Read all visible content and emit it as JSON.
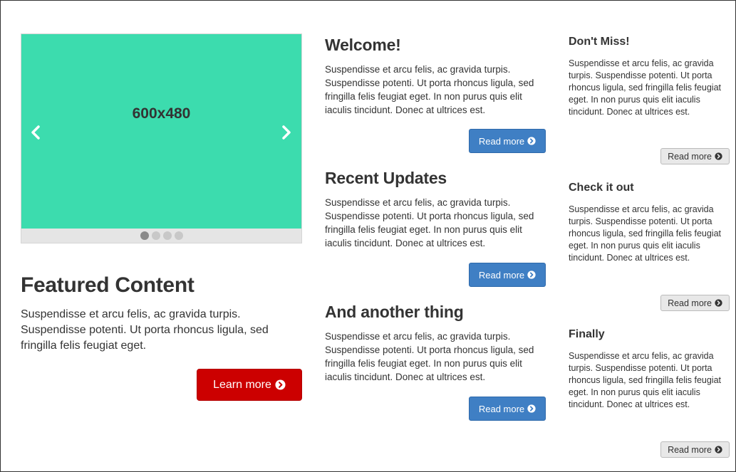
{
  "carousel": {
    "slide_label": "600x480",
    "slide_color": "#3cdcae",
    "indicators": 4,
    "active_index": 0
  },
  "featured": {
    "title": "Featured Content",
    "text": "Suspendisse et arcu felis, ac gravida turpis. Suspendisse potenti. Ut porta rhoncus ligula, sed fringilla felis feugiat eget.",
    "button_label": "Learn more",
    "button_color": "#cc0000"
  },
  "middle": [
    {
      "title": "Welcome!",
      "text": "Suspendisse et arcu felis, ac gravida turpis. Suspendisse potenti. Ut porta rhoncus ligula, sed fringilla felis feugiat eget. In non purus quis elit iaculis tincidunt. Donec at ultrices est.",
      "button_label": "Read more"
    },
    {
      "title": "Recent Updates",
      "text": "Suspendisse et arcu felis, ac gravida turpis. Suspendisse potenti. Ut porta rhoncus ligula, sed fringilla felis feugiat eget. In non purus quis elit iaculis tincidunt. Donec at ultrices est.",
      "button_label": "Read more"
    },
    {
      "title": "And another thing",
      "text": "Suspendisse et arcu felis, ac gravida turpis. Suspendisse potenti. Ut porta rhoncus ligula, sed fringilla felis feugiat eget. In non purus quis elit iaculis tincidunt. Donec at ultrices est.",
      "button_label": "Read more"
    }
  ],
  "right": [
    {
      "title": "Don't Miss!",
      "text": "Suspendisse et arcu felis, ac gravida turpis. Suspendisse potenti. Ut porta rhoncus ligula, sed fringilla felis feugiat eget. In non purus quis elit iaculis tincidunt. Donec at ultrices est.",
      "button_label": "Read more"
    },
    {
      "title": "Check it out",
      "text": "Suspendisse et arcu felis, ac gravida turpis. Suspendisse potenti. Ut porta rhoncus ligula, sed fringilla felis feugiat eget. In non purus quis elit iaculis tincidunt. Donec at ultrices est.",
      "button_label": "Read more"
    },
    {
      "title": "Finally",
      "text": "Suspendisse et arcu felis, ac gravida turpis. Suspendisse potenti. Ut porta rhoncus ligula, sed fringilla felis feugiat eget. In non purus quis elit iaculis tincidunt. Donec at ultrices est.",
      "button_label": "Read more"
    }
  ],
  "colors": {
    "primary": "#3f7fc4",
    "danger": "#cc0000",
    "default": "#e8e8e8"
  },
  "icons": {
    "carousel_prev": "chevron-left-icon",
    "carousel_next": "chevron-right-icon",
    "button_icon": "arrow-circle-right-icon"
  }
}
